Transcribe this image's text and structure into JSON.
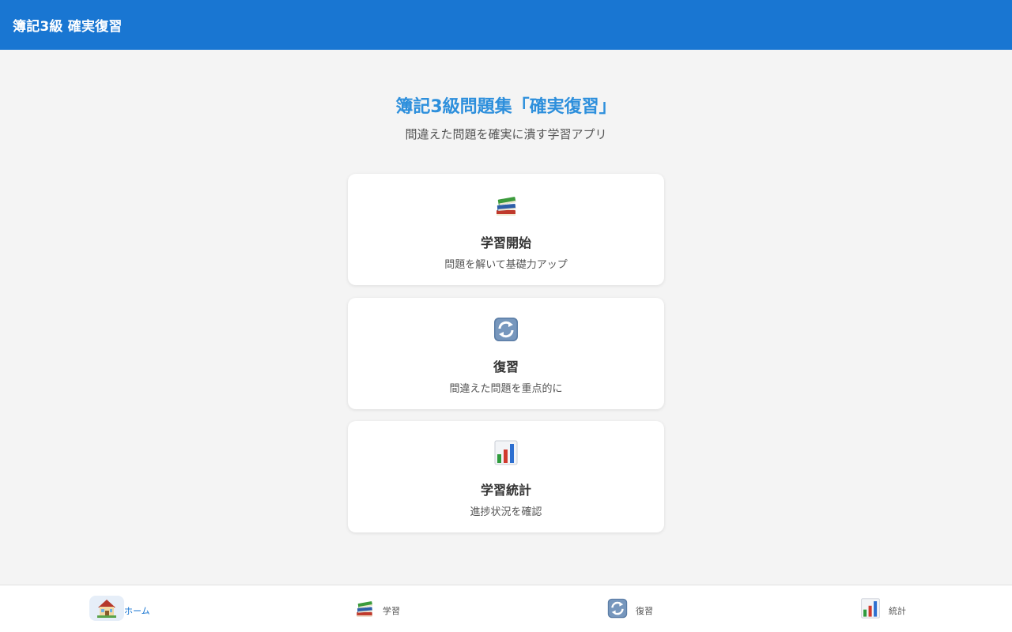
{
  "header": {
    "title": "簿記3級 確実復習"
  },
  "hero": {
    "title": "簿記3級問題集「確実復習」",
    "subtitle": "間違えた問題を確実に潰す学習アプリ"
  },
  "cards": [
    {
      "icon": "books-icon",
      "title": "学習開始",
      "description": "問題を解いて基礎力アップ"
    },
    {
      "icon": "refresh-icon",
      "title": "復習",
      "description": "間違えた問題を重点的に"
    },
    {
      "icon": "bar-chart-icon",
      "title": "学習統計",
      "description": "進捗状況を確認"
    }
  ],
  "nav": {
    "active": "ホーム",
    "items": [
      {
        "icon": "house-icon",
        "label": "ホーム"
      },
      {
        "icon": "books-icon",
        "label": "学習"
      },
      {
        "icon": "refresh-icon",
        "label": "復習"
      },
      {
        "icon": "bar-chart-icon",
        "label": "統計"
      }
    ]
  },
  "colors": {
    "header": "#1976d2",
    "accent_title": "#2d8fdc",
    "background": "#f4f4f4"
  }
}
